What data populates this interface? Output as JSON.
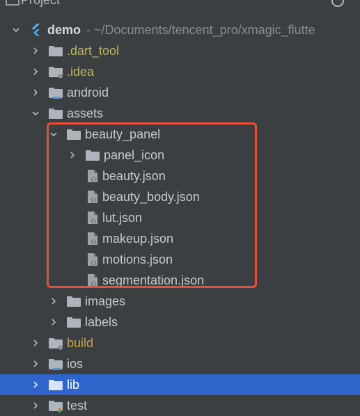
{
  "header": {
    "title": "Project"
  },
  "root": {
    "name": "demo",
    "path": "~/Documents/tencent_pro/xmagic_flutte"
  },
  "tree": [
    {
      "label": "dart_tool",
      "display": ".dart_tool",
      "level": 1,
      "expanded": false,
      "icon": "folder",
      "style": "muted"
    },
    {
      "label": "idea",
      "display": ".idea",
      "level": 1,
      "expanded": false,
      "icon": "folder-settings",
      "style": "muted"
    },
    {
      "label": "android",
      "display": "android",
      "level": 1,
      "expanded": false,
      "icon": "folder-android",
      "style": "normal"
    },
    {
      "label": "assets",
      "display": "assets",
      "level": 1,
      "expanded": true,
      "icon": "folder",
      "style": "normal"
    },
    {
      "label": "beauty_panel",
      "display": "beauty_panel",
      "level": 2,
      "expanded": true,
      "icon": "folder",
      "style": "normal"
    },
    {
      "label": "panel_icon",
      "display": "panel_icon",
      "level": 3,
      "expanded": false,
      "icon": "folder",
      "style": "normal"
    },
    {
      "label": "beauty.json",
      "display": "beauty.json",
      "level": 3,
      "leaf": true,
      "icon": "json-file",
      "style": "normal"
    },
    {
      "label": "beauty_body.json",
      "display": "beauty_body.json",
      "level": 3,
      "leaf": true,
      "icon": "json-file",
      "style": "normal"
    },
    {
      "label": "lut.json",
      "display": "lut.json",
      "level": 3,
      "leaf": true,
      "icon": "json-file",
      "style": "normal"
    },
    {
      "label": "makeup.json",
      "display": "makeup.json",
      "level": 3,
      "leaf": true,
      "icon": "json-file",
      "style": "normal"
    },
    {
      "label": "motions.json",
      "display": "motions.json",
      "level": 3,
      "leaf": true,
      "icon": "json-file",
      "style": "normal"
    },
    {
      "label": "segmentation.json",
      "display": "segmentation.json",
      "level": 3,
      "leaf": true,
      "icon": "json-file",
      "style": "normal"
    },
    {
      "label": "images",
      "display": "images",
      "level": 2,
      "expanded": false,
      "icon": "folder",
      "style": "normal"
    },
    {
      "label": "labels",
      "display": "labels",
      "level": 2,
      "expanded": false,
      "icon": "folder",
      "style": "normal"
    },
    {
      "label": "build",
      "display": "build",
      "level": 1,
      "expanded": false,
      "icon": "folder-settings",
      "style": "orange"
    },
    {
      "label": "ios",
      "display": "ios",
      "level": 1,
      "expanded": false,
      "icon": "folder-ios",
      "style": "normal"
    },
    {
      "label": "lib",
      "display": "lib",
      "level": 1,
      "expanded": false,
      "icon": "folder-blue",
      "style": "selected"
    },
    {
      "label": "test",
      "display": "test",
      "level": 1,
      "expanded": false,
      "icon": "folder-test",
      "style": "normal"
    }
  ],
  "colors": {
    "background": "#3c3f41",
    "selection": "#2f65ca",
    "highlight_border": "#e5503a",
    "muted_text": "#bcb860",
    "build_text": "#c7a14a",
    "text": "#c9c9c9"
  }
}
